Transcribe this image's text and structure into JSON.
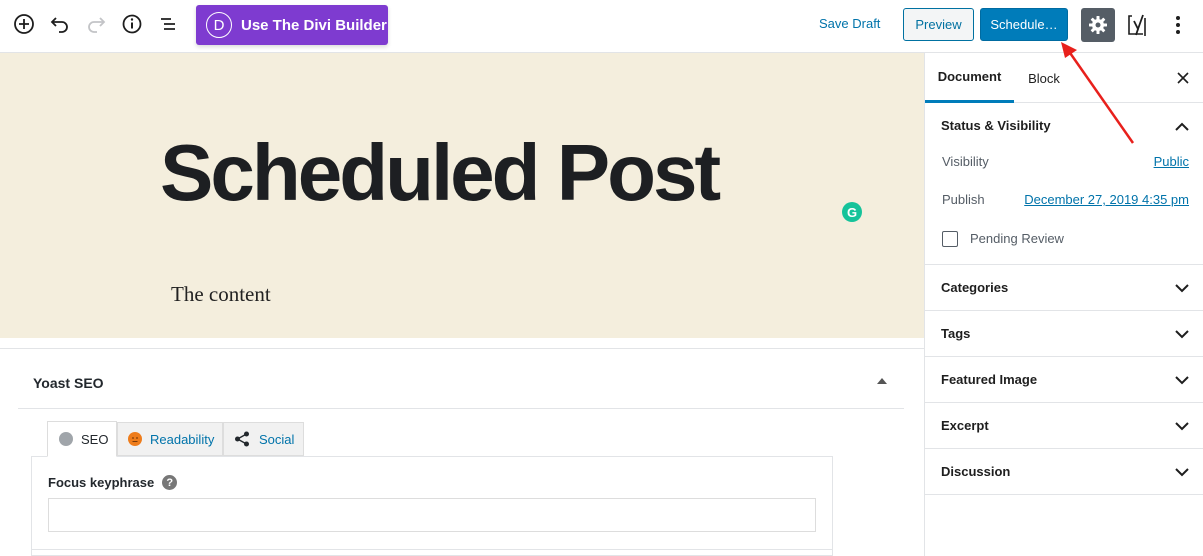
{
  "toolbar": {
    "divi_builder_label": "Use The Divi Builder",
    "divi_logo_letter": "D",
    "save_draft_label": "Save Draft",
    "preview_label": "Preview",
    "schedule_label": "Schedule…"
  },
  "editor": {
    "title": "Scheduled Post",
    "content": "The content",
    "grammarly_letter": "G"
  },
  "yoast": {
    "title": "Yoast SEO",
    "tabs": [
      {
        "label": "SEO"
      },
      {
        "label": "Readability"
      },
      {
        "label": "Social"
      }
    ],
    "focus_keyphrase_label": "Focus keyphrase",
    "help_glyph": "?"
  },
  "sidebar": {
    "tabs": [
      {
        "label": "Document"
      },
      {
        "label": "Block"
      }
    ],
    "status_visibility": {
      "title": "Status & Visibility",
      "visibility_label": "Visibility",
      "visibility_value": "Public",
      "publish_label": "Publish",
      "publish_value": "December 27, 2019 4:35 pm",
      "pending_review_label": "Pending Review"
    },
    "panels": [
      {
        "title": "Categories"
      },
      {
        "title": "Tags"
      },
      {
        "title": "Featured Image"
      },
      {
        "title": "Excerpt"
      },
      {
        "title": "Discussion"
      }
    ]
  },
  "colors": {
    "accent": "#007cba",
    "divi": "#7e3bd0",
    "editor_bg": "#f4eedd",
    "annotation_arrow": "#e8201c",
    "seo_dot": "#a0a5aa",
    "readability_dot": "#ee7c1b"
  }
}
